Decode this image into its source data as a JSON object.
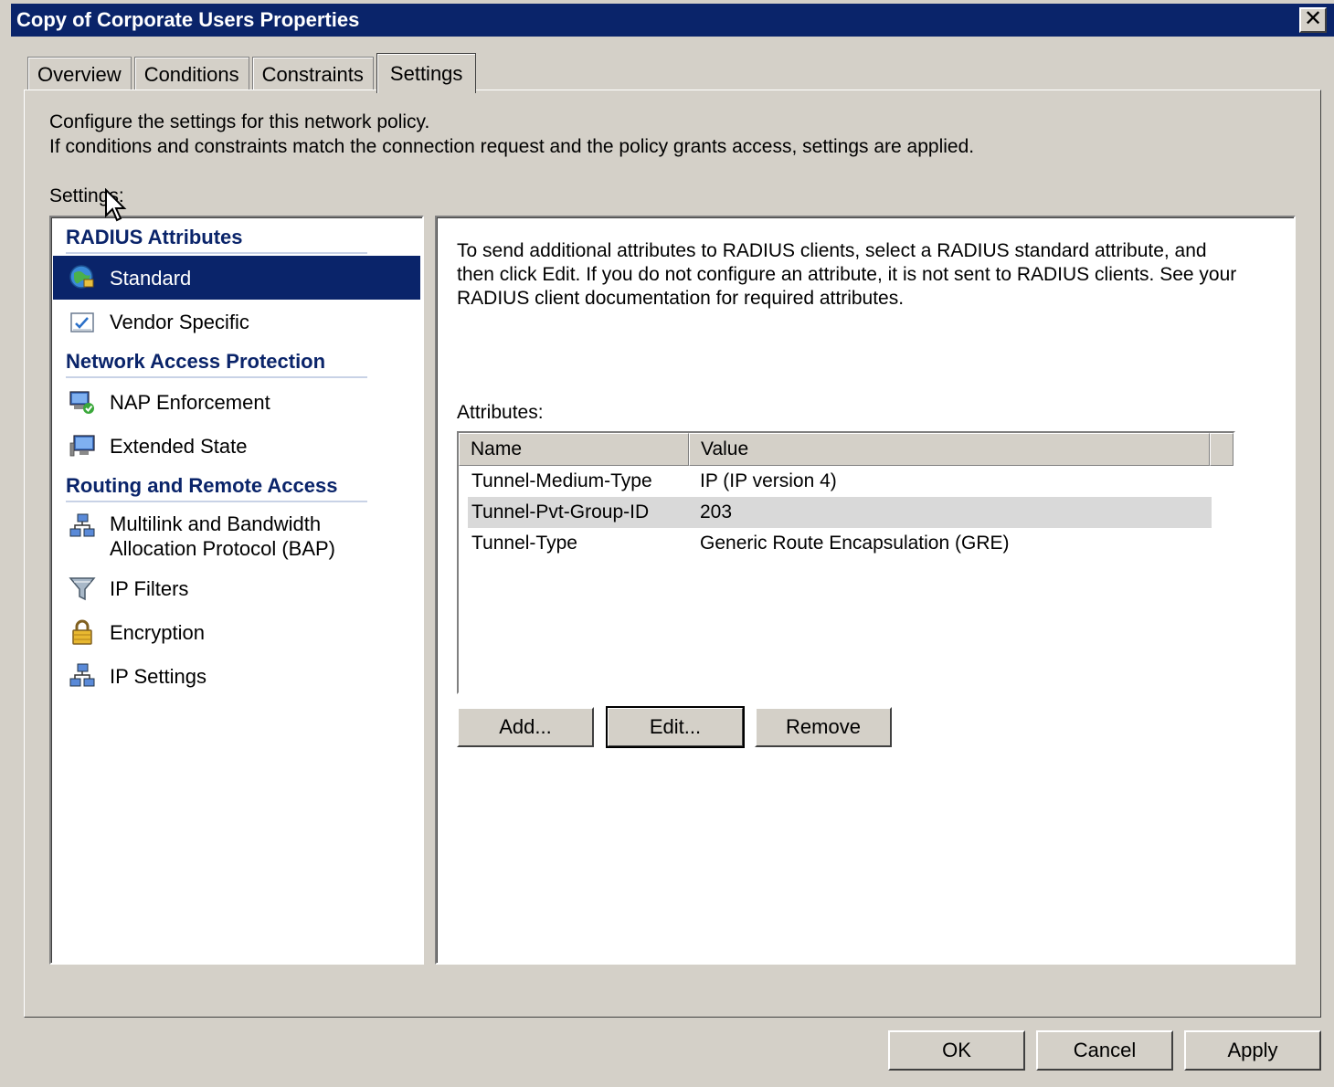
{
  "window": {
    "title": "Copy of Corporate Users Properties",
    "close_glyph": "✕"
  },
  "tabs": [
    {
      "label": "Overview",
      "active": false
    },
    {
      "label": "Conditions",
      "active": false
    },
    {
      "label": "Constraints",
      "active": false
    },
    {
      "label": "Settings",
      "active": true
    }
  ],
  "description": {
    "line1": "Configure the settings for this network policy.",
    "line2": "If conditions and constraints match the connection request and the policy grants access, settings are applied."
  },
  "settings_label": "Settings:",
  "settings_list": {
    "groups": [
      {
        "header": "RADIUS Attributes"
      },
      {
        "header": "Network Access Protection"
      },
      {
        "header": "Routing and Remote Access"
      }
    ],
    "items": [
      {
        "label": "Standard",
        "icon": "globe-network-icon",
        "selected": true
      },
      {
        "label": "Vendor Specific",
        "icon": "checklist-icon",
        "selected": false
      },
      {
        "label": "NAP Enforcement",
        "icon": "computer-check-icon",
        "selected": false
      },
      {
        "label": "Extended State",
        "icon": "monitor-icon",
        "selected": false
      },
      {
        "label_line1": "Multilink and Bandwidth",
        "label_line2": "Allocation Protocol (BAP)",
        "icon": "network-computers-icon",
        "selected": false
      },
      {
        "label": "IP Filters",
        "icon": "funnel-icon",
        "selected": false
      },
      {
        "label": "Encryption",
        "icon": "padlock-icon",
        "selected": false
      },
      {
        "label": "IP Settings",
        "icon": "network-computers-icon",
        "selected": false
      }
    ]
  },
  "detail": {
    "description": "To send additional attributes to RADIUS clients, select a RADIUS standard attribute, and then click Edit. If you do not configure an attribute, it is not sent to RADIUS clients. See your RADIUS client documentation for required attributes.",
    "attributes_label": "Attributes:",
    "columns": [
      "Name",
      "Value"
    ],
    "rows": [
      {
        "name": "Tunnel-Medium-Type",
        "value": "IP (IP version 4)"
      },
      {
        "name": "Tunnel-Pvt-Group-ID",
        "value": "203"
      },
      {
        "name": "Tunnel-Type",
        "value": "Generic Route Encapsulation (GRE)"
      }
    ],
    "buttons": {
      "add": "Add...",
      "edit": "Edit...",
      "remove": "Remove"
    }
  },
  "footer": {
    "ok": "OK",
    "cancel": "Cancel",
    "apply": "Apply"
  },
  "colors": {
    "title_bar": "#0a246a",
    "selection": "#0a246a",
    "group_header": "#0a246a",
    "dialog_bg": "#d4d0c8"
  }
}
